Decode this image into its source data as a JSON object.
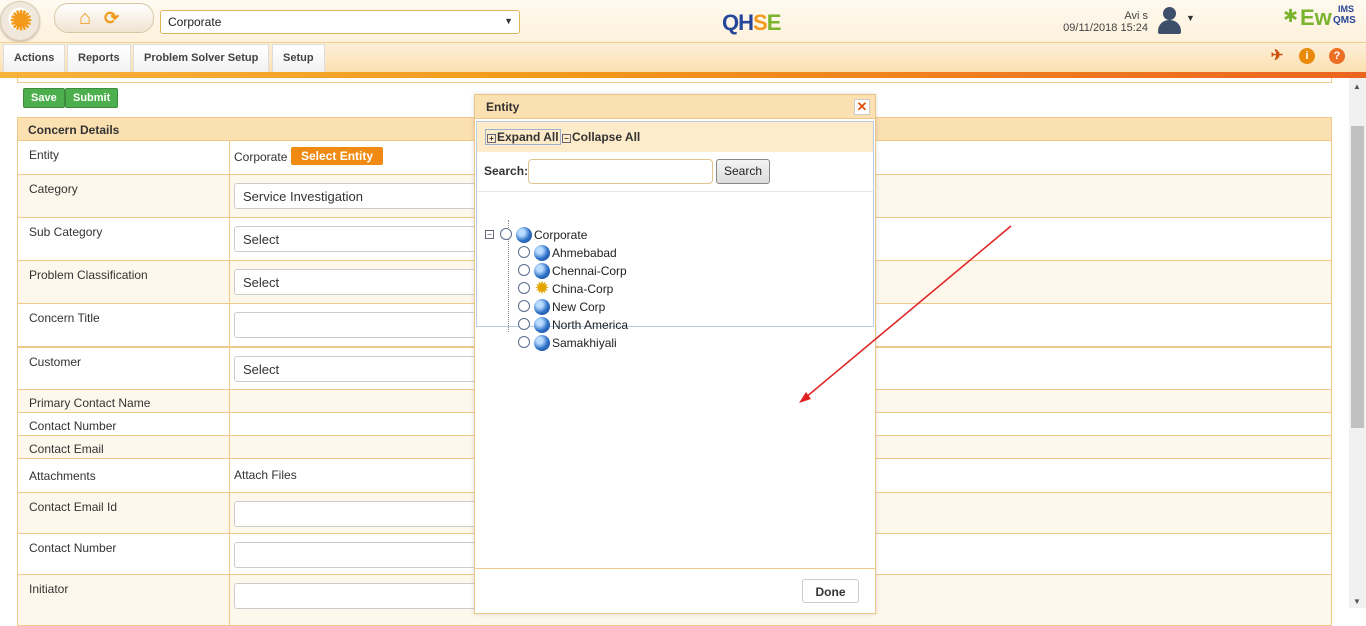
{
  "header": {
    "entity_selected": "Corporate",
    "product_logo": "QHSE",
    "brand_logo": {
      "ew": "Ew",
      "ims": "IMS",
      "qms": "QMS"
    },
    "user_name": "Avi s",
    "datetime": "09/11/2018 15:24",
    "icons": [
      "sun-logo-icon",
      "home-icon",
      "refresh-icon",
      "user-avatar-icon",
      "chevron-down-icon"
    ]
  },
  "menu": {
    "items": [
      "Actions",
      "Reports",
      "Problem Solver Setup",
      "Setup"
    ],
    "tool_icons": [
      "pin-icon",
      "info-icon",
      "help-icon"
    ]
  },
  "form": {
    "save_label": "Save",
    "submit_label": "Submit",
    "section_title": "Concern Details",
    "entity_label": "Entity",
    "entity_value": "Corporate",
    "select_entity_label": "Select Entity",
    "rows": [
      {
        "label": "Category",
        "value": "Service Investigation"
      },
      {
        "label": "Sub Category",
        "value": "Select"
      },
      {
        "label": "Problem Classification",
        "value": "Select"
      },
      {
        "label": "Concern Title",
        "value": ""
      },
      {
        "label": "Customer",
        "value": "Select"
      },
      {
        "label": "Primary Contact Name",
        "value": ""
      },
      {
        "label": "Contact Number",
        "value": ""
      },
      {
        "label": "Contact Email",
        "value": ""
      },
      {
        "label": "Attachments",
        "value": "Attach Files"
      },
      {
        "label": "Contact Email Id",
        "value": ""
      },
      {
        "label": "Contact Number",
        "value": ""
      },
      {
        "label": "Initiator",
        "value": ""
      }
    ]
  },
  "modal": {
    "title": "Entity",
    "expand_all": "Expand All",
    "collapse_all": "Collapse All",
    "search_label": "Search:",
    "search_value": "",
    "search_button": "Search",
    "tree_root": "Corporate",
    "tree_children": [
      "Ahmebabad",
      "Chennai-Corp",
      "China-Corp",
      "New Corp",
      "North America",
      "Samakhiyali"
    ],
    "done_label": "Done"
  },
  "colors": {
    "accent_orange": "#f08a12",
    "header_bg": "#fbe0b2",
    "border": "#f0c98b",
    "save_green": "#4cae4c",
    "arrow_red": "#e02020"
  }
}
